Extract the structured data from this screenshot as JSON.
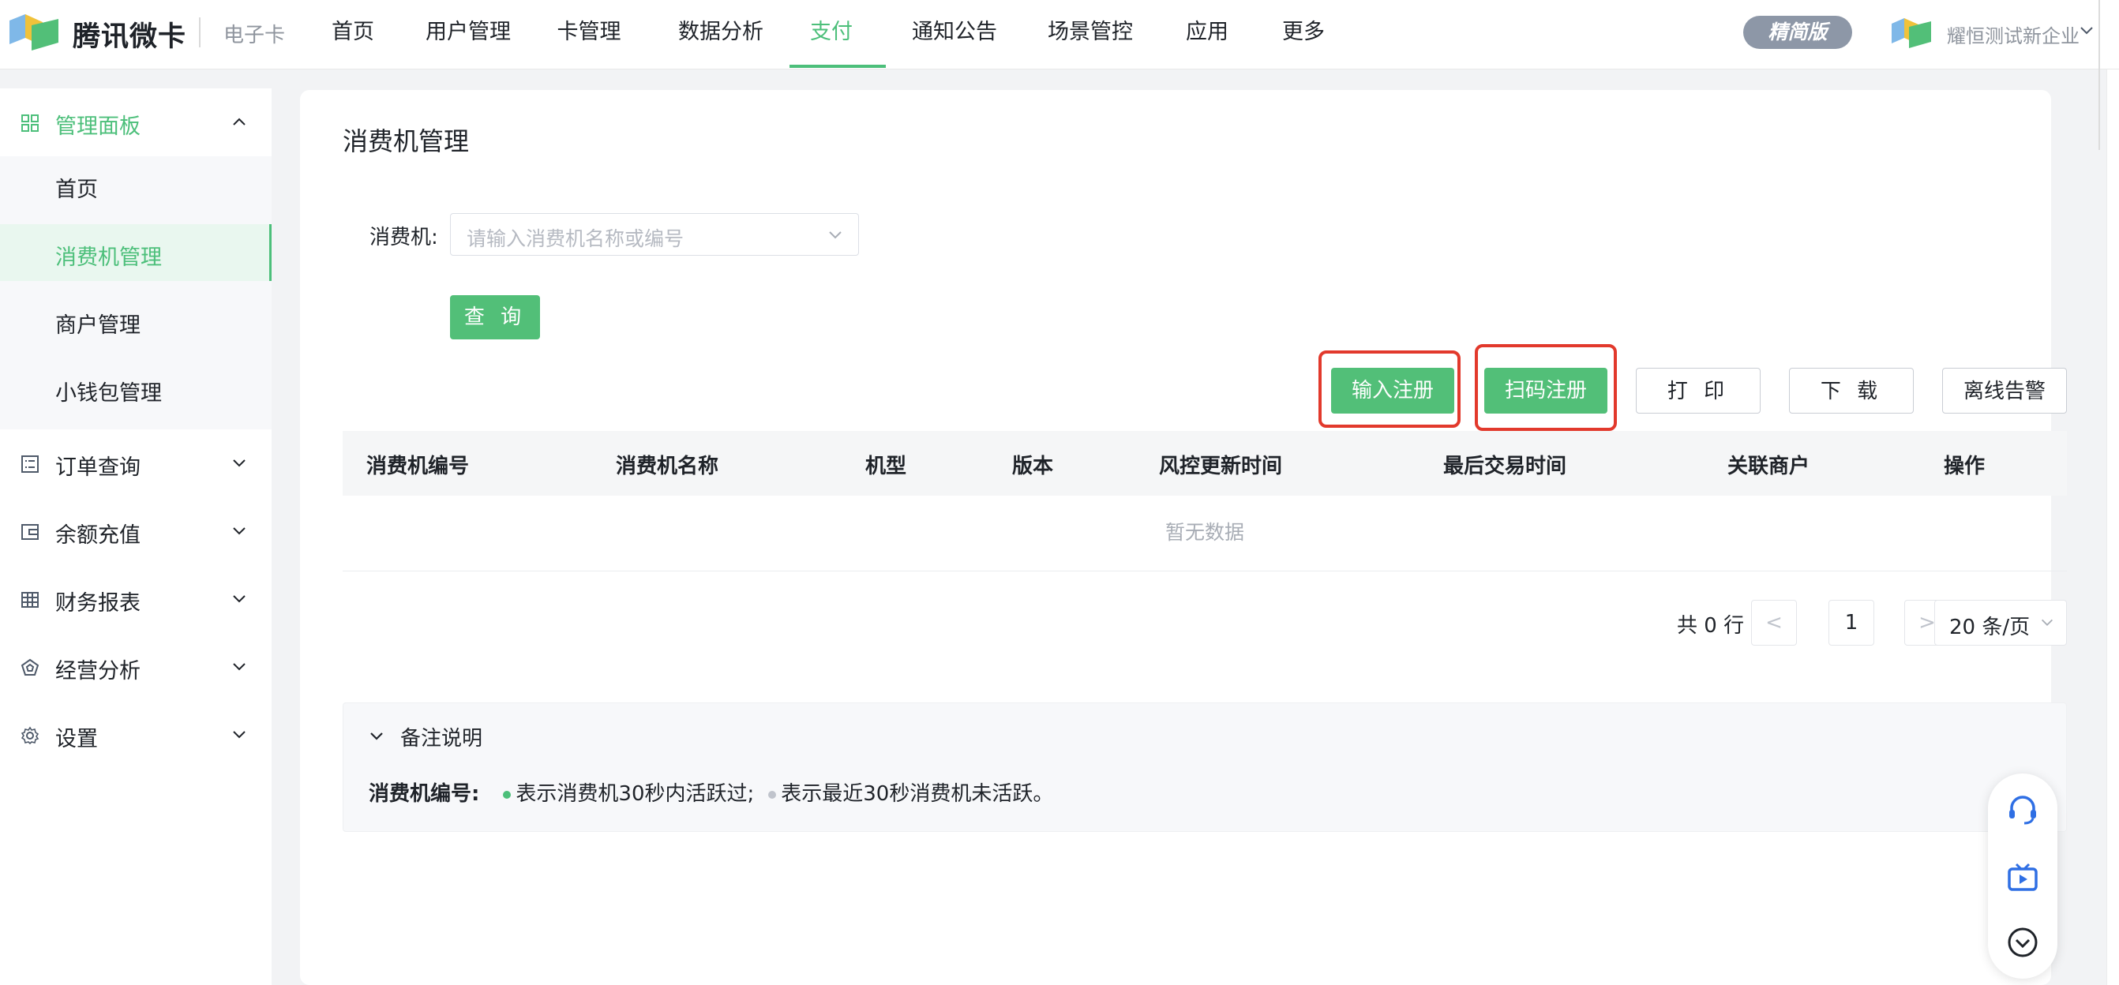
{
  "header": {
    "brand": "腾讯微卡",
    "product": "电子卡",
    "nav": [
      {
        "label": "首页",
        "active": false
      },
      {
        "label": "用户管理",
        "active": false
      },
      {
        "label": "卡管理",
        "active": false
      },
      {
        "label": "数据分析",
        "active": false
      },
      {
        "label": "支付",
        "active": true
      },
      {
        "label": "通知公告",
        "active": false
      },
      {
        "label": "场景管控",
        "active": false
      },
      {
        "label": "应用",
        "active": false
      },
      {
        "label": "更多",
        "active": false
      }
    ],
    "edition_badge": "精简版",
    "org_name": "耀恒测试新企业"
  },
  "sidebar": {
    "groups": [
      {
        "label": "管理面板",
        "icon": "grid-icon",
        "expanded": true,
        "items": [
          {
            "label": "首页",
            "active": false
          },
          {
            "label": "消费机管理",
            "active": true
          },
          {
            "label": "商户管理",
            "active": false
          },
          {
            "label": "小钱包管理",
            "active": false
          }
        ]
      },
      {
        "label": "订单查询",
        "icon": "list-icon",
        "expanded": false
      },
      {
        "label": "余额充值",
        "icon": "wallet-icon",
        "expanded": false
      },
      {
        "label": "财务报表",
        "icon": "table-icon",
        "expanded": false
      },
      {
        "label": "经营分析",
        "icon": "chart-icon",
        "expanded": false
      },
      {
        "label": "设置",
        "icon": "gear-icon",
        "expanded": false
      }
    ]
  },
  "main": {
    "title": "消费机管理",
    "filter": {
      "label": "消费机:",
      "placeholder": "请输入消费机名称或编号"
    },
    "query_button": "查 询",
    "actions": {
      "register_input": "输入注册",
      "register_scan": "扫码注册",
      "print": "打 印",
      "download": "下 载",
      "offline_alert": "离线告警"
    },
    "table": {
      "columns": [
        "消费机编号",
        "消费机名称",
        "机型",
        "版本",
        "风控更新时间",
        "最后交易时间",
        "关联商户",
        "操作"
      ],
      "empty_text": "暂无数据"
    },
    "pagination": {
      "total_text": "共 0 行",
      "prev": "<",
      "current_page": "1",
      "next": ">",
      "page_size": "20 条/页"
    },
    "notes": {
      "title": "备注说明",
      "key": "消费机编号:",
      "active_text": "表示消费机30秒内活跃过;",
      "inactive_text": "表示最近30秒消费机未活跃。",
      "active_color": "#4cbf7a",
      "inactive_color": "#c0c4cc"
    }
  },
  "colors": {
    "accent": "#4cbf7a",
    "button_primary": "#52bf78",
    "highlight": "#e2392c",
    "float_icon": "#2f6fe4"
  },
  "float_toolbar": [
    "headset-icon",
    "video-tutorial-icon",
    "collapse-circle-icon"
  ]
}
